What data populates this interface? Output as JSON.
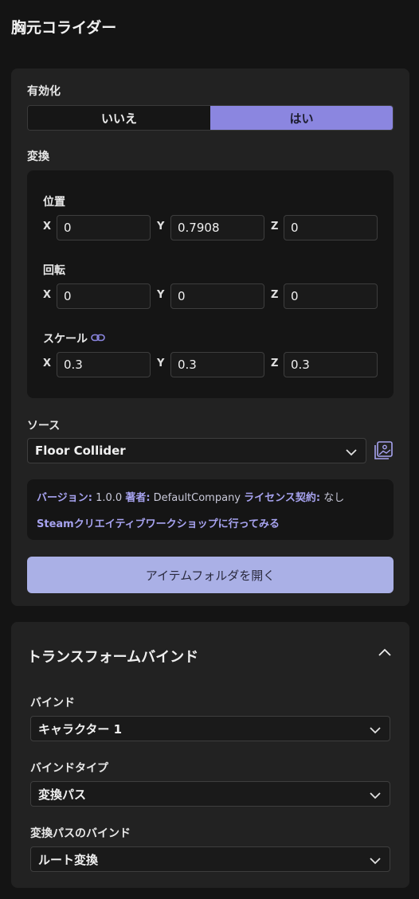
{
  "page": {
    "title": "胸元コライダー"
  },
  "enabled": {
    "label": "有効化",
    "options": [
      "いいえ",
      "はい"
    ],
    "selected": "はい"
  },
  "transform": {
    "label": "変換",
    "position": {
      "label": "位置",
      "x": "0",
      "y": "0.7908",
      "z": "0"
    },
    "rotation": {
      "label": "回転",
      "x": "0",
      "y": "0",
      "z": "0"
    },
    "scale": {
      "label": "スケール",
      "x": "0.3",
      "y": "0.3",
      "z": "0.3"
    },
    "axes": {
      "x": "X",
      "y": "Y",
      "z": "Z"
    }
  },
  "source": {
    "label": "ソース",
    "selected": "Floor Collider",
    "info": {
      "version_key": "バージョン:",
      "version_val": "1.0.0",
      "author_key": "著者:",
      "author_val": "DefaultCompany",
      "license_key": "ライセンス契約:",
      "license_val": "なし",
      "workshop_link": "Steamクリエイティブワークショップに行ってみる"
    },
    "open_folder": "アイテムフォルダを開く"
  },
  "transform_bind": {
    "title": "トランスフォームバインド",
    "bind": {
      "label": "バインド",
      "value": "キャラクター 1"
    },
    "bind_type": {
      "label": "バインドタイプ",
      "value": "変換パス"
    },
    "path_bind": {
      "label": "変換パスのバインド",
      "value": "ルート変換"
    }
  },
  "colors": {
    "accent": "#8b86e0",
    "button": "#aab0e6",
    "link": "#a7a3f0"
  },
  "icons": [
    "link-icon",
    "folder-image-icon",
    "chevron-down-icon",
    "chevron-up-icon"
  ]
}
